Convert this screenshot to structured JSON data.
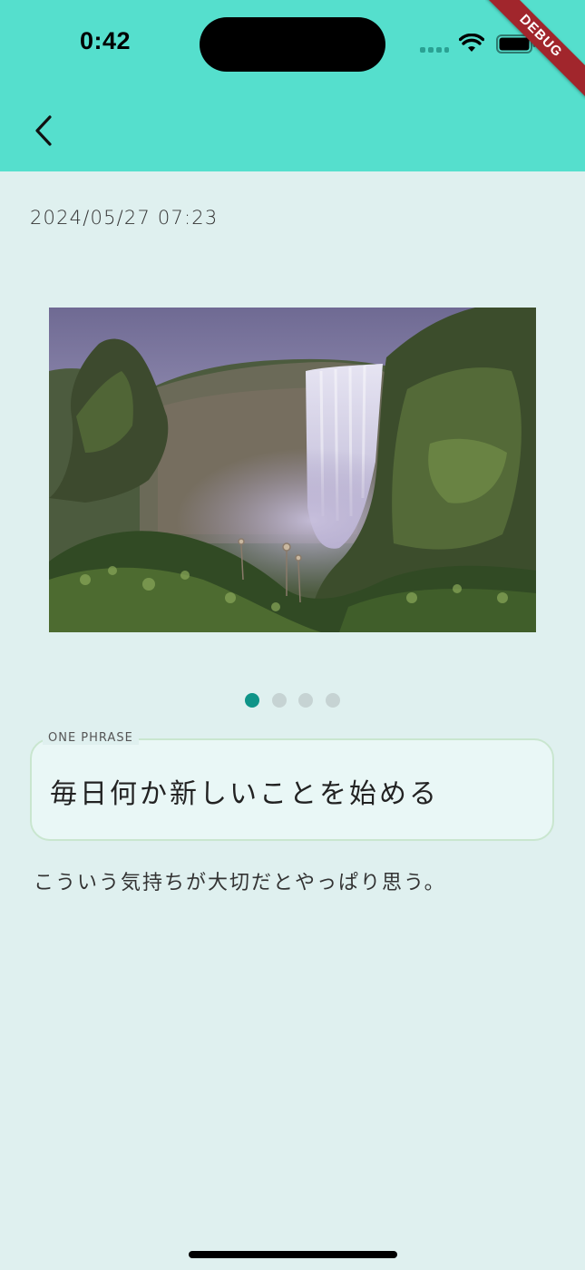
{
  "status_bar": {
    "time": "0:42",
    "icons": [
      "cellular-signal-icon",
      "wifi-icon",
      "battery-icon"
    ]
  },
  "debug_banner": "DEBUG",
  "header": {
    "back_icon": "chevron-left-icon"
  },
  "entry": {
    "date": "2024/05/27 07:23",
    "photo": {
      "subject": "waterfall-landscape",
      "page_count": 4,
      "active_page": 0
    },
    "one_phrase": {
      "label": "ONE PHRASE",
      "text": "毎日何か新しいことを始める"
    },
    "body": "こういう気持ちが大切だとやっぱり思う。"
  },
  "colors": {
    "app_bar": "#55dfcd",
    "background": "#dff0ef",
    "dot_active": "#0f9488",
    "dot_inactive": "#c6d3d3",
    "phrase_border": "#c9e6cf",
    "debug_ribbon": "#a1262c"
  }
}
